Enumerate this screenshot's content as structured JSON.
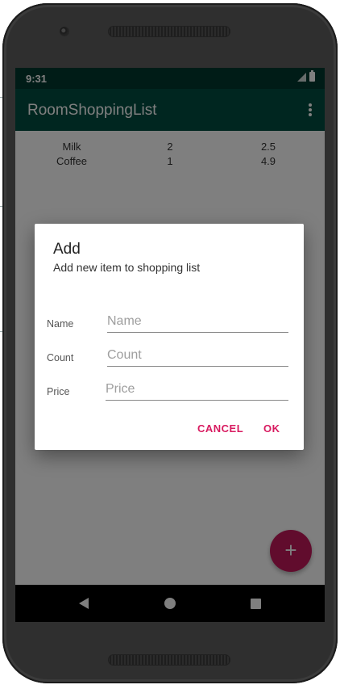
{
  "status_bar": {
    "time": "9:31"
  },
  "app_bar": {
    "title": "RoomShoppingList",
    "overflow_icon": "more-vert-icon"
  },
  "shopping_list": {
    "items": [
      {
        "name": "Milk",
        "count": "2",
        "price": "2.5"
      },
      {
        "name": "Coffee",
        "count": "1",
        "price": "4.9"
      }
    ]
  },
  "fab": {
    "label": "+",
    "icon": "add-icon"
  },
  "dialog": {
    "title": "Add",
    "message": "Add new item to shopping list",
    "fields": {
      "name": {
        "label": "Name",
        "placeholder": "Name",
        "value": ""
      },
      "count": {
        "label": "Count",
        "placeholder": "Count",
        "value": ""
      },
      "price": {
        "label": "Price",
        "placeholder": "Price",
        "value": ""
      }
    },
    "cancel_label": "CANCEL",
    "ok_label": "OK"
  },
  "colors": {
    "status_bar": "#00382f",
    "app_bar": "#004d40",
    "accent": "#d81b60",
    "fab": "#c2185b"
  }
}
